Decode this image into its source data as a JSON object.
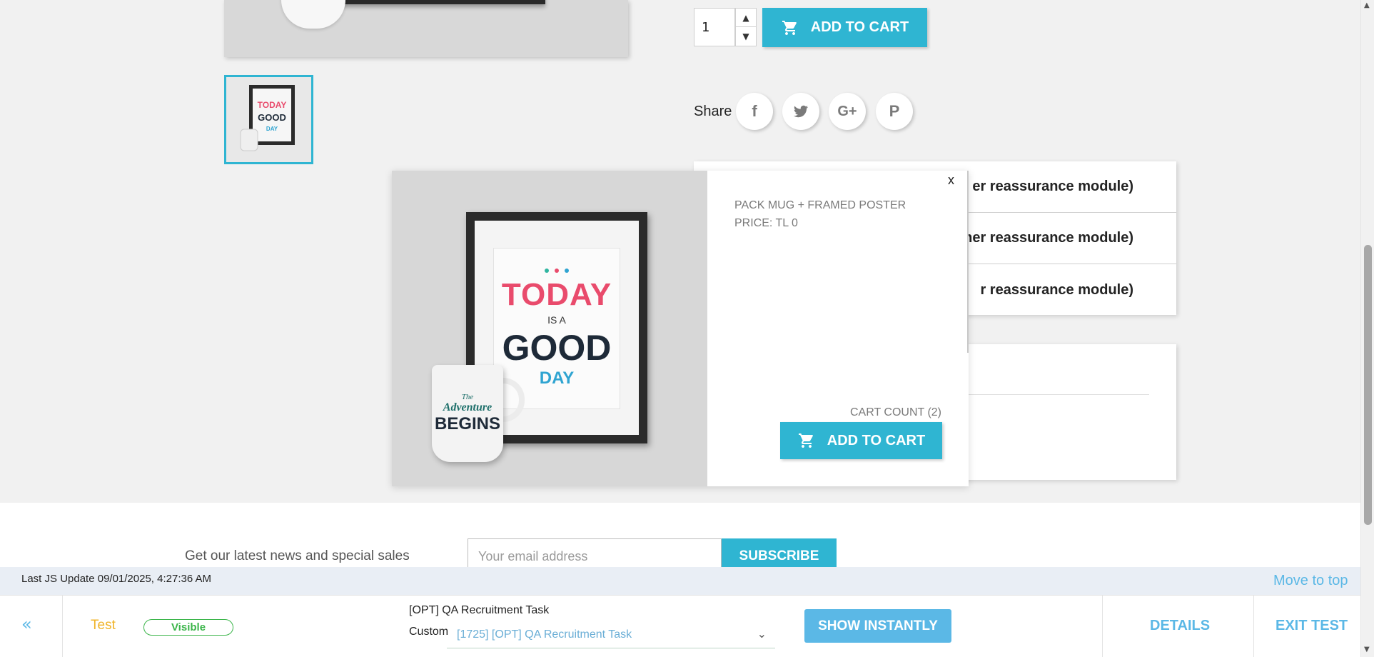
{
  "product": {
    "quantity": "1",
    "add_to_cart_label": "ADD TO CART",
    "share_label": "Share",
    "share_icons": [
      "facebook-icon",
      "twitter-icon",
      "google-plus-icon",
      "pinterest-icon"
    ]
  },
  "reassurance": {
    "rows": [
      "er reassurance module)",
      "her reassurance module)",
      "r reassurance module)"
    ]
  },
  "popup": {
    "close_label": "x",
    "product_name": "PACK MUG + FRAMED POSTER",
    "price": "PRICE: TL 0",
    "cart_count": "CART COUNT (2)",
    "add_to_cart_label": "ADD TO CART",
    "poster_text": {
      "today": "TODAY",
      "is_a": "IS A",
      "good": "GOOD",
      "day": "DAY"
    },
    "mug_text": {
      "the": "The",
      "adventure": "Adventure",
      "begins": "BEGINS"
    }
  },
  "newsletter": {
    "label": "Get our latest news and special sales",
    "placeholder": "Your email address",
    "subscribe_label": "SUBSCRIBE"
  },
  "test_bar": {
    "last_update": "Last JS Update 09/01/2025, 4:27:36 AM",
    "move_to_top": "Move to top",
    "back_label": "«",
    "test_name": "Test",
    "status_badge": "Visible",
    "task_title": "[OPT] QA Recruitment Task",
    "custom_label": "Custom",
    "task_select_value": "[1725] [OPT] QA Recruitment Task",
    "show_instantly": "SHOW INSTANTLY",
    "details": "DETAILS",
    "exit_test": "EXIT TEST"
  },
  "colors": {
    "brand": "#2fb5d2",
    "test_accent": "#5bb8e6",
    "test_name": "#f0b429",
    "visible_green": "#3bb54a"
  }
}
